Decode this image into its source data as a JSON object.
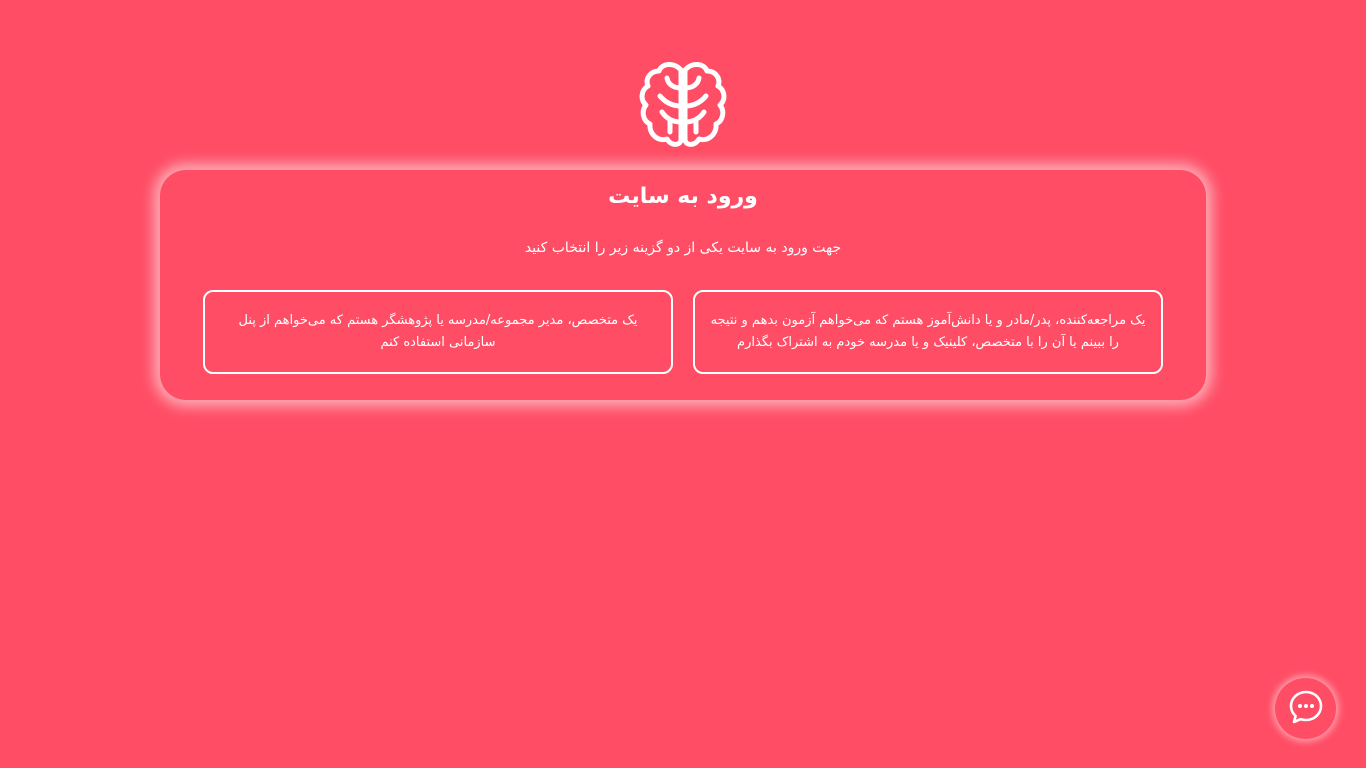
{
  "login": {
    "title": "ورود به سایت",
    "subtitle": "جهت ورود به سایت یکی از دو گزینه زیر را انتخاب کنید",
    "options": [
      {
        "label": "یک مراجعه‌کننده، پدر/مادر و یا دانش‌آموز هستم که می‌خواهم آزمون بدهم و نتیجه را ببینم یا آن را با متخصص، کلینیک و یا مدرسه خودم به اشتراک بگذارم"
      },
      {
        "label": "یک متخصص، مدیر مجموعه/مدرسه یا پژوهشگر هستم که می‌خواهم از پنل سازمانی استفاده کنم"
      }
    ]
  },
  "icons": {
    "logo": "brain-icon",
    "chat": "chat-bubble-icon"
  },
  "colors": {
    "background": "#ff4d65",
    "foreground": "#ffffff"
  }
}
